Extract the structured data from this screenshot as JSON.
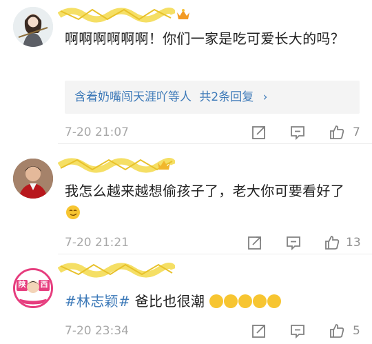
{
  "comments": [
    {
      "text": "啊啊啊啊啊啊！你们一家是吃可爱长大的吗？",
      "reply_summary": {
        "names": "含着奶嘴闯天涯吖等人",
        "count": "共2条回复"
      },
      "time": "7-20 21:07",
      "likes": "7"
    },
    {
      "text": "我怎么越来越想偷孩子了，老大你可要看好了",
      "time": "7-20 21:21",
      "likes": "13"
    },
    {
      "hashtag": "#林志颖#",
      "text": " 爸比也很潮",
      "avatar_text": [
        "陕",
        "西"
      ],
      "time": "7-20 23:34",
      "likes": "5"
    }
  ],
  "icons": {
    "reply_chevron": "chevron-right-icon",
    "forward": "share-icon",
    "comment": "comment-icon",
    "like": "thumbs-up-icon"
  },
  "colors": {
    "link": "#3c79b8",
    "meta": "#a8a8a8",
    "scribble": "#f3d94a"
  }
}
